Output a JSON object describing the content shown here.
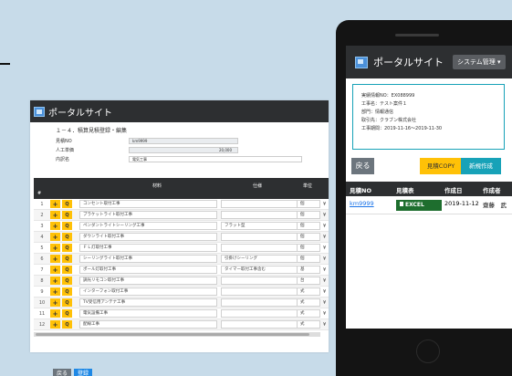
{
  "desktop": {
    "brand": "ポータルサイト",
    "heading": "１－４．積算見積登録・編集",
    "fields": [
      {
        "label": "見積NO",
        "value": "km9999"
      },
      {
        "label": "人工単価",
        "value": "20,000"
      },
      {
        "label": "内訳名",
        "value": "電気工事"
      }
    ],
    "columns": {
      "num": "#",
      "material": "材料",
      "spec": "仕様",
      "unit": "単位"
    },
    "rows": [
      {
        "n": "1",
        "material": "コンセント取付工事",
        "spec": "",
        "unit": "個"
      },
      {
        "n": "2",
        "material": "ブラケットライト取付工事",
        "spec": "",
        "unit": "個"
      },
      {
        "n": "3",
        "material": "ペンダントライトシーリング工事",
        "spec": "フラット型",
        "unit": "個"
      },
      {
        "n": "4",
        "material": "ダウンライト取付工事",
        "spec": "",
        "unit": "個"
      },
      {
        "n": "5",
        "material": "ＦＬ灯取付工事",
        "spec": "",
        "unit": "個"
      },
      {
        "n": "6",
        "material": "シーリングライト取付工事",
        "spec": "引掛けシーリング",
        "unit": "個"
      },
      {
        "n": "7",
        "material": "ポール灯取付工事",
        "spec": "タイマー取付工事含む",
        "unit": "基"
      },
      {
        "n": "8",
        "material": "調光リモコン取付工事",
        "spec": "",
        "unit": "台"
      },
      {
        "n": "9",
        "material": "インターフォン取付工事",
        "spec": "",
        "unit": "式"
      },
      {
        "n": "10",
        "material": "TV受信用アンテナ工事",
        "spec": "",
        "unit": "式"
      },
      {
        "n": "11",
        "material": "電気設備工事",
        "spec": "",
        "unit": "式"
      },
      {
        "n": "12",
        "material": "配線工事",
        "spec": "",
        "unit": "式"
      }
    ],
    "plus_symbol": "+",
    "search_symbol": "Q",
    "dropdown_symbol": "¥",
    "buttons": {
      "back": "戻る",
      "save": "登録"
    }
  },
  "phone": {
    "brand": "ポータルサイト",
    "menu": "システム管理",
    "info": [
      "実績情報NO：EX088999",
      "工事名：テスト案件１",
      "部門：情報通信",
      "取引先：クラブン株式会社",
      "工事期間：2019-11-16〜2019-11-30"
    ],
    "buttons": {
      "back": "戻る",
      "copy": "見積COPY",
      "new": "新規作成"
    },
    "table": {
      "headers": [
        "見積NO",
        "見積表",
        "作成日",
        "作成者"
      ],
      "row": {
        "no": "km9999",
        "excel": "EXCEL",
        "date": "2019-11-12",
        "author": "齋藤　武"
      }
    }
  }
}
